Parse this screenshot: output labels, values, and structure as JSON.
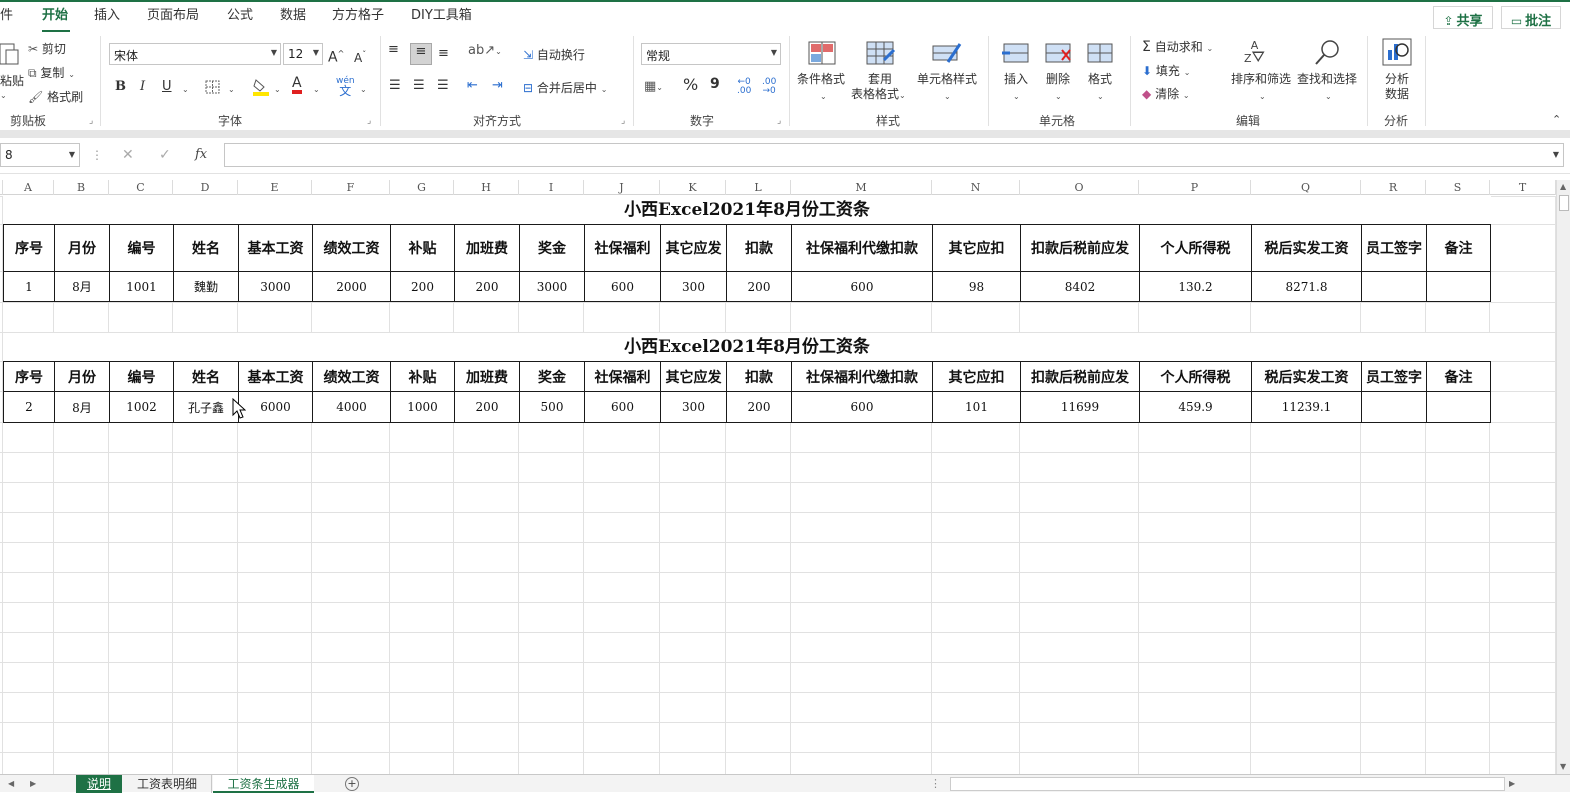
{
  "menu": {
    "tabs": [
      "件",
      "开始",
      "插入",
      "页面布局",
      "公式",
      "数据",
      "方方格子",
      "DIY工具箱"
    ],
    "share": "共享",
    "comment": "批注"
  },
  "ribbon": {
    "clipboard": {
      "paste": "粘贴",
      "cut": "剪切",
      "copy": "复制",
      "format_painter": "格式刷",
      "label": "剪贴板"
    },
    "font": {
      "name": "宋体",
      "size": "12",
      "bold": "B",
      "italic": "I",
      "underline": "U",
      "grow": "A",
      "shrink": "A",
      "color_a": "A",
      "phonetic": "wén",
      "label": "字体"
    },
    "alignment": {
      "wrap": "自动换行",
      "merge": "合并后居中",
      "label": "对齐方式"
    },
    "number": {
      "format": "常规",
      "percent": "%",
      "comma": "9",
      "inc_decimal": ".00",
      "label": "数字"
    },
    "styles": {
      "conditional": "条件格式",
      "table_format_1": "套用",
      "table_format_2": "表格格式",
      "cell_style": "单元格样式",
      "label": "样式"
    },
    "cells": {
      "insert": "插入",
      "delete": "删除",
      "format": "格式",
      "label": "单元格"
    },
    "editing": {
      "autosum": "自动求和",
      "fill": "填充",
      "clear": "清除",
      "sort_filter": "排序和筛选",
      "find_select": "查找和选择",
      "label": "编辑"
    },
    "analysis": {
      "analyze_1": "分析",
      "analyze_2": "数据",
      "label": "分析"
    }
  },
  "formula_bar": {
    "name_box": "8",
    "cancel": "✕",
    "enter": "✓",
    "fx": "fx",
    "value": ""
  },
  "columns": [
    "A",
    "B",
    "C",
    "D",
    "E",
    "F",
    "G",
    "H",
    "I",
    "J",
    "K",
    "L",
    "M",
    "N",
    "O",
    "P",
    "Q",
    "R",
    "S",
    "T"
  ],
  "sheet": {
    "block1": {
      "title": "小西Excel2021年8月份工资条",
      "headers": [
        "序号",
        "月份",
        "编号",
        "姓名",
        "基本工资",
        "绩效工资",
        "补贴",
        "加班费",
        "奖金",
        "社保福利",
        "其它应发",
        "扣款",
        "社保福利代缴扣款",
        "其它应扣",
        "扣款后税前应发",
        "个人所得税",
        "税后实发工资",
        "员工签字",
        "备注"
      ],
      "values": [
        "1",
        "8月",
        "1001",
        "魏勤",
        "3000",
        "2000",
        "200",
        "200",
        "3000",
        "600",
        "300",
        "200",
        "600",
        "98",
        "8402",
        "130.2",
        "8271.8",
        "",
        ""
      ]
    },
    "block2": {
      "title": "小西Excel2021年8月份工资条",
      "headers": [
        "序号",
        "月份",
        "编号",
        "姓名",
        "基本工资",
        "绩效工资",
        "补贴",
        "加班费",
        "奖金",
        "社保福利",
        "其它应发",
        "扣款",
        "社保福利代缴扣款",
        "其它应扣",
        "扣款后税前应发",
        "个人所得税",
        "税后实发工资",
        "员工签字",
        "备注"
      ],
      "values": [
        "2",
        "8月",
        "1002",
        "孔子鑫",
        "6000",
        "4000",
        "1000",
        "200",
        "500",
        "600",
        "300",
        "200",
        "600",
        "101",
        "11699",
        "459.9",
        "11239.1",
        "",
        ""
      ]
    }
  },
  "sheet_tabs": [
    "说明",
    "工资表明细",
    "工资条生成器"
  ],
  "colors": {
    "accent": "#1e7145",
    "grid": "#e1e1e1",
    "border": "#1a1a1a"
  }
}
